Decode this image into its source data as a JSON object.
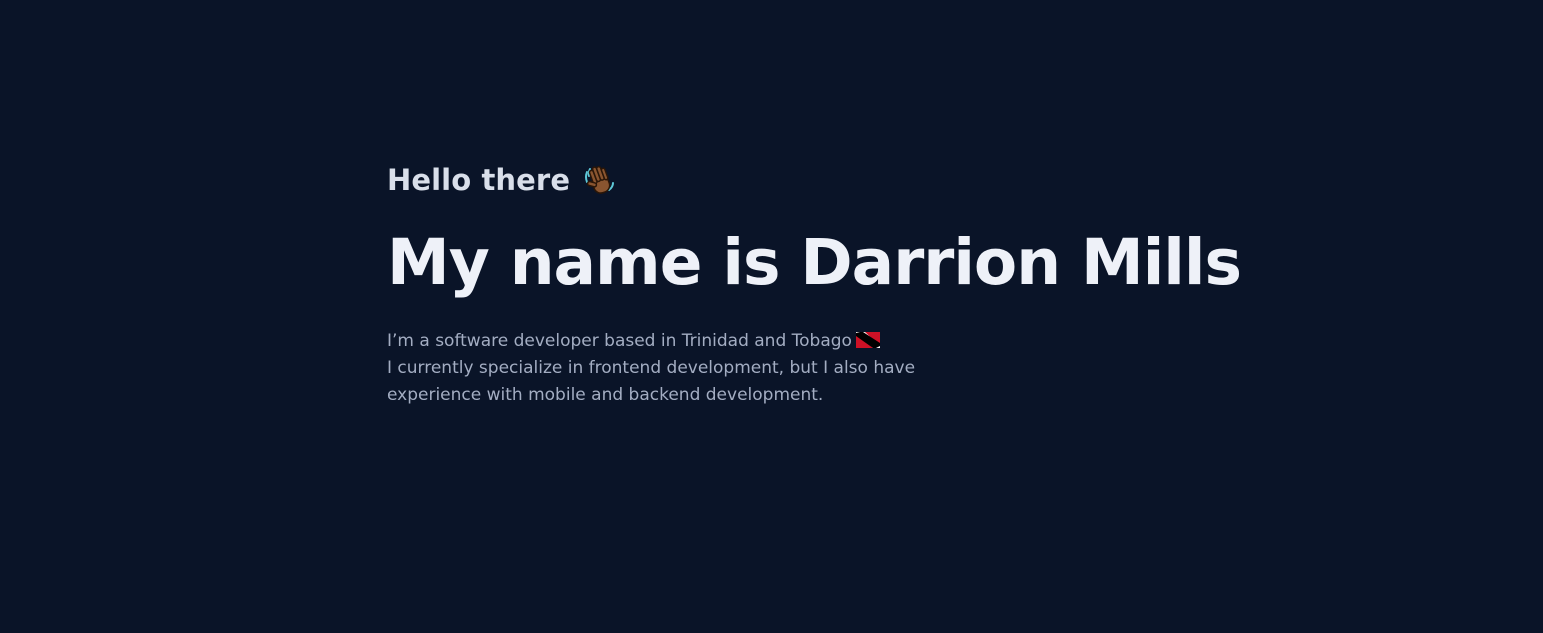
{
  "hero": {
    "greeting": "Hello there",
    "greeting_icon": "waving-hand-icon",
    "headline": "My name is Darrion Mills",
    "bio_line_1": "I’m a software developer based in Trinidad and Tobago",
    "bio_line_1_icon": "trinidad-and-tobago-flag-icon",
    "bio_line_2": "I currently specialize in frontend development, but I also have",
    "bio_line_3": "experience with mobile and backend development."
  },
  "colors": {
    "background": "#0a1428",
    "greeting_text": "#d9dfea",
    "headline_text": "#eef1f8",
    "bio_text": "#a3adc2",
    "flag_red": "#ce1126",
    "flag_black": "#000000",
    "flag_white": "#ffffff",
    "wave_skin": "#8a5530"
  }
}
